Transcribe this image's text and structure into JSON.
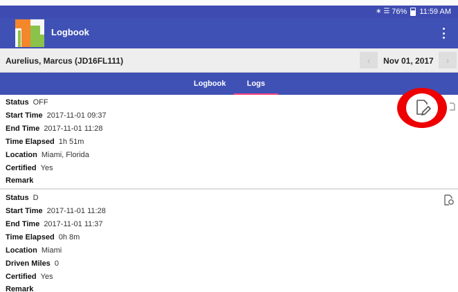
{
  "status_bar": {
    "battery": "76%",
    "time": "11:59 AM"
  },
  "app_bar": {
    "title": "Logbook",
    "menu_icon": "more-vert-icon"
  },
  "info_bar": {
    "driver": "Aurelius, Marcus (JD16FL111)",
    "date": "Nov 01, 2017"
  },
  "tabs": [
    {
      "label": "Logbook",
      "selected": false
    },
    {
      "label": "Logs",
      "selected": true
    }
  ],
  "colors": {
    "app_bar": "#4051b5",
    "tab_indicator": "#ff4081",
    "highlight_circle": "#ee0000"
  },
  "logs": [
    {
      "rows": [
        {
          "key": "Status",
          "value": "OFF"
        },
        {
          "key": "Start Time",
          "value": "2017-11-01 09:37"
        },
        {
          "key": "End Time",
          "value": "2017-11-01 11:28"
        },
        {
          "key": "Time Elapsed",
          "value": "1h 51m"
        },
        {
          "key": "Location",
          "value": "Miami, Florida"
        },
        {
          "key": "Certified",
          "value": "Yes"
        },
        {
          "key": "Remark",
          "value": ""
        }
      ],
      "action_icon": "edit-icon"
    },
    {
      "rows": [
        {
          "key": "Status",
          "value": "D"
        },
        {
          "key": "Start Time",
          "value": "2017-11-01 11:28"
        },
        {
          "key": "End Time",
          "value": "2017-11-01 11:37"
        },
        {
          "key": "Time Elapsed",
          "value": "0h 8m"
        },
        {
          "key": "Location",
          "value": "Miami"
        },
        {
          "key": "Driven Miles",
          "value": "0"
        },
        {
          "key": "Certified",
          "value": "Yes"
        },
        {
          "key": "Remark",
          "value": ""
        }
      ],
      "action_icon": "edit-icon"
    }
  ]
}
